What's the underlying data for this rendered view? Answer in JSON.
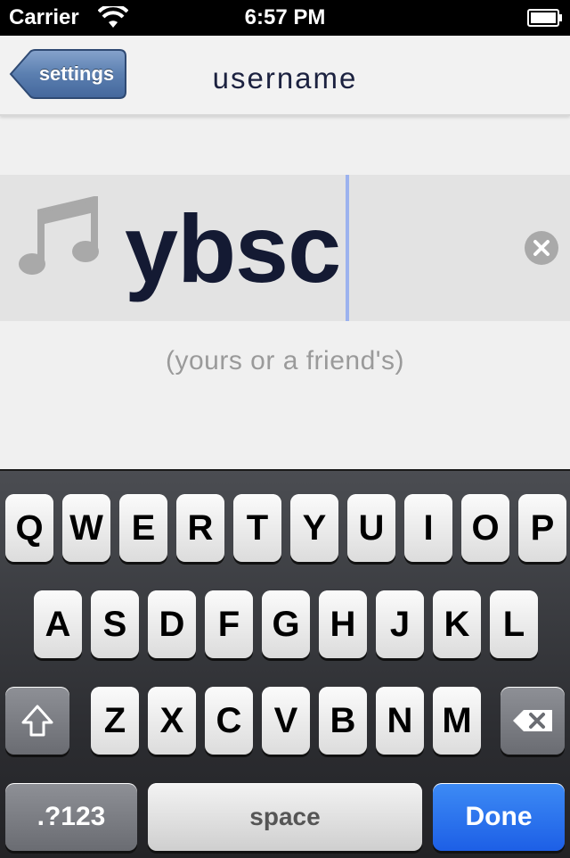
{
  "status_bar": {
    "carrier": "Carrier",
    "time": "6:57 PM"
  },
  "nav": {
    "back_label": "settings",
    "title": "username"
  },
  "username_field": {
    "value": "ybsc"
  },
  "hint": "(yours or a friend's)",
  "keyboard": {
    "row1": [
      "Q",
      "W",
      "E",
      "R",
      "T",
      "Y",
      "U",
      "I",
      "O",
      "P"
    ],
    "row2": [
      "A",
      "S",
      "D",
      "F",
      "G",
      "H",
      "J",
      "K",
      "L"
    ],
    "row3": [
      "Z",
      "X",
      "C",
      "V",
      "B",
      "N",
      "M"
    ],
    "numbers_label": ".?123",
    "space_label": "space",
    "done_label": "Done"
  },
  "colors": {
    "accent": "#1d5fe6",
    "back_button": "#5b7fb0",
    "input_text": "#141a33",
    "caret": "#9cb2ee"
  },
  "icons": {
    "music": "music-note-icon",
    "clear": "clear-icon",
    "shift": "shift-icon",
    "delete": "backspace-icon"
  }
}
